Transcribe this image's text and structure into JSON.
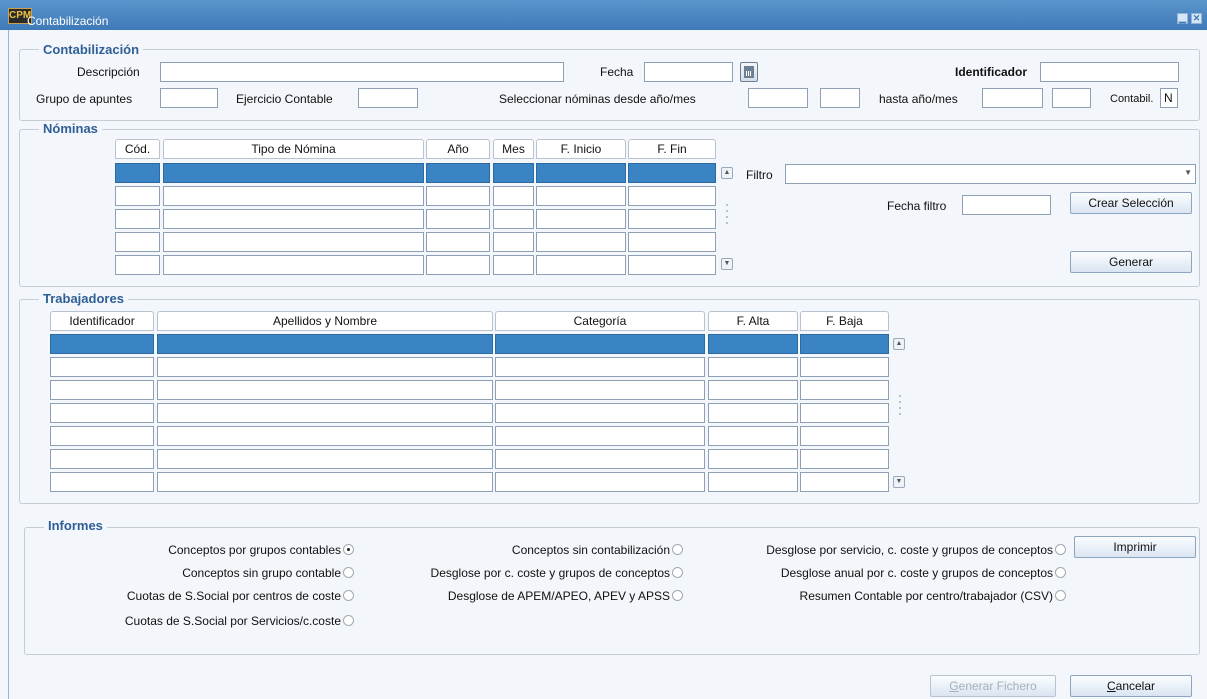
{
  "window": {
    "title": "Contabilización",
    "logo": "CPM",
    "minimize_icon": "minimize-icon",
    "close_icon": "close-icon"
  },
  "contab": {
    "legend": "Contabilización",
    "descripcion_label": "Descripción",
    "descripcion_value": "",
    "fecha_label": "Fecha",
    "fecha_value": "",
    "calendar_icon": "calendar-icon",
    "identificador_label": "Identificador",
    "identificador_value": "",
    "grupo_label": "Grupo de apuntes",
    "grupo_value": "",
    "ejercicio_label": "Ejercicio Contable",
    "ejercicio_value": "",
    "seleccionar_label": "Seleccionar nóminas desde año/mes",
    "desde_anio": "",
    "desde_mes": "",
    "hasta_label": "hasta año/mes",
    "hasta_anio": "",
    "hasta_mes": "",
    "contabil_label": "Contabil.",
    "contabil_value": "N"
  },
  "nominas": {
    "legend": "Nóminas",
    "columns": [
      "Cód.",
      "Tipo de Nómina",
      "Año",
      "Mes",
      "F. Inicio",
      "F. Fin"
    ],
    "row_count": 5,
    "filtro_label": "Filtro",
    "filtro_value": "",
    "fecha_filtro_label": "Fecha filtro",
    "fecha_filtro_value": "",
    "crear_seleccion_button": "Crear Selección",
    "generar_button": "Generar"
  },
  "trabajadores": {
    "legend": "Trabajadores",
    "columns": [
      "Identificador",
      "Apellidos y Nombre",
      "Categoría",
      "F. Alta",
      "F. Baja"
    ],
    "row_count": 7
  },
  "informes": {
    "legend": "Informes",
    "options": [
      {
        "label": "Conceptos por grupos contables",
        "selected": true
      },
      {
        "label": "Conceptos sin grupo contable",
        "selected": false
      },
      {
        "label": "Cuotas de S.Social por centros de coste",
        "selected": false
      },
      {
        "label": "Cuotas de S.Social por Servicios/c.coste",
        "selected": false
      },
      {
        "label": "Conceptos sin contabilización",
        "selected": false
      },
      {
        "label": "Desglose por c. coste y grupos de conceptos",
        "selected": false
      },
      {
        "label": "Desglose de APEM/APEO, APEV y APSS",
        "selected": false
      },
      {
        "label": "Desglose por servicio, c. coste y grupos de conceptos",
        "selected": false
      },
      {
        "label": "Desglose anual por c. coste y grupos de conceptos",
        "selected": false
      },
      {
        "label": "Resumen Contable por centro/trabajador (CSV)",
        "selected": false
      }
    ],
    "imprimir_button": "Imprimir"
  },
  "footer": {
    "generar_fichero_button": "Generar Fichero",
    "cancelar_button": "Cancelar"
  },
  "colors": {
    "title_bar": "#4a87c2",
    "selected_row": "#3a84c4",
    "legend_text": "#2f5f96"
  }
}
